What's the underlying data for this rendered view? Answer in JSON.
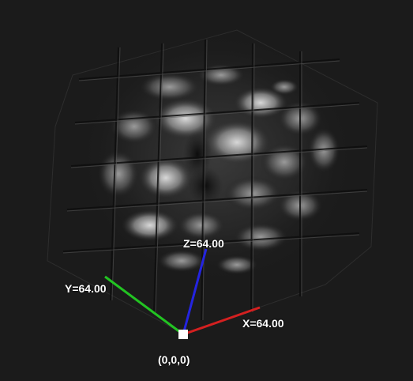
{
  "viewer": {
    "background": "#1b1b1b",
    "origin_label": "(0,0,0)",
    "axes": {
      "x": {
        "label": "X=64.00",
        "color": "#d42020"
      },
      "y": {
        "label": "Y=64.00",
        "color": "#22c322"
      },
      "z": {
        "label": "Z=64.00",
        "color": "#2424e0"
      }
    },
    "origin_marker_color": "#ffffff"
  }
}
